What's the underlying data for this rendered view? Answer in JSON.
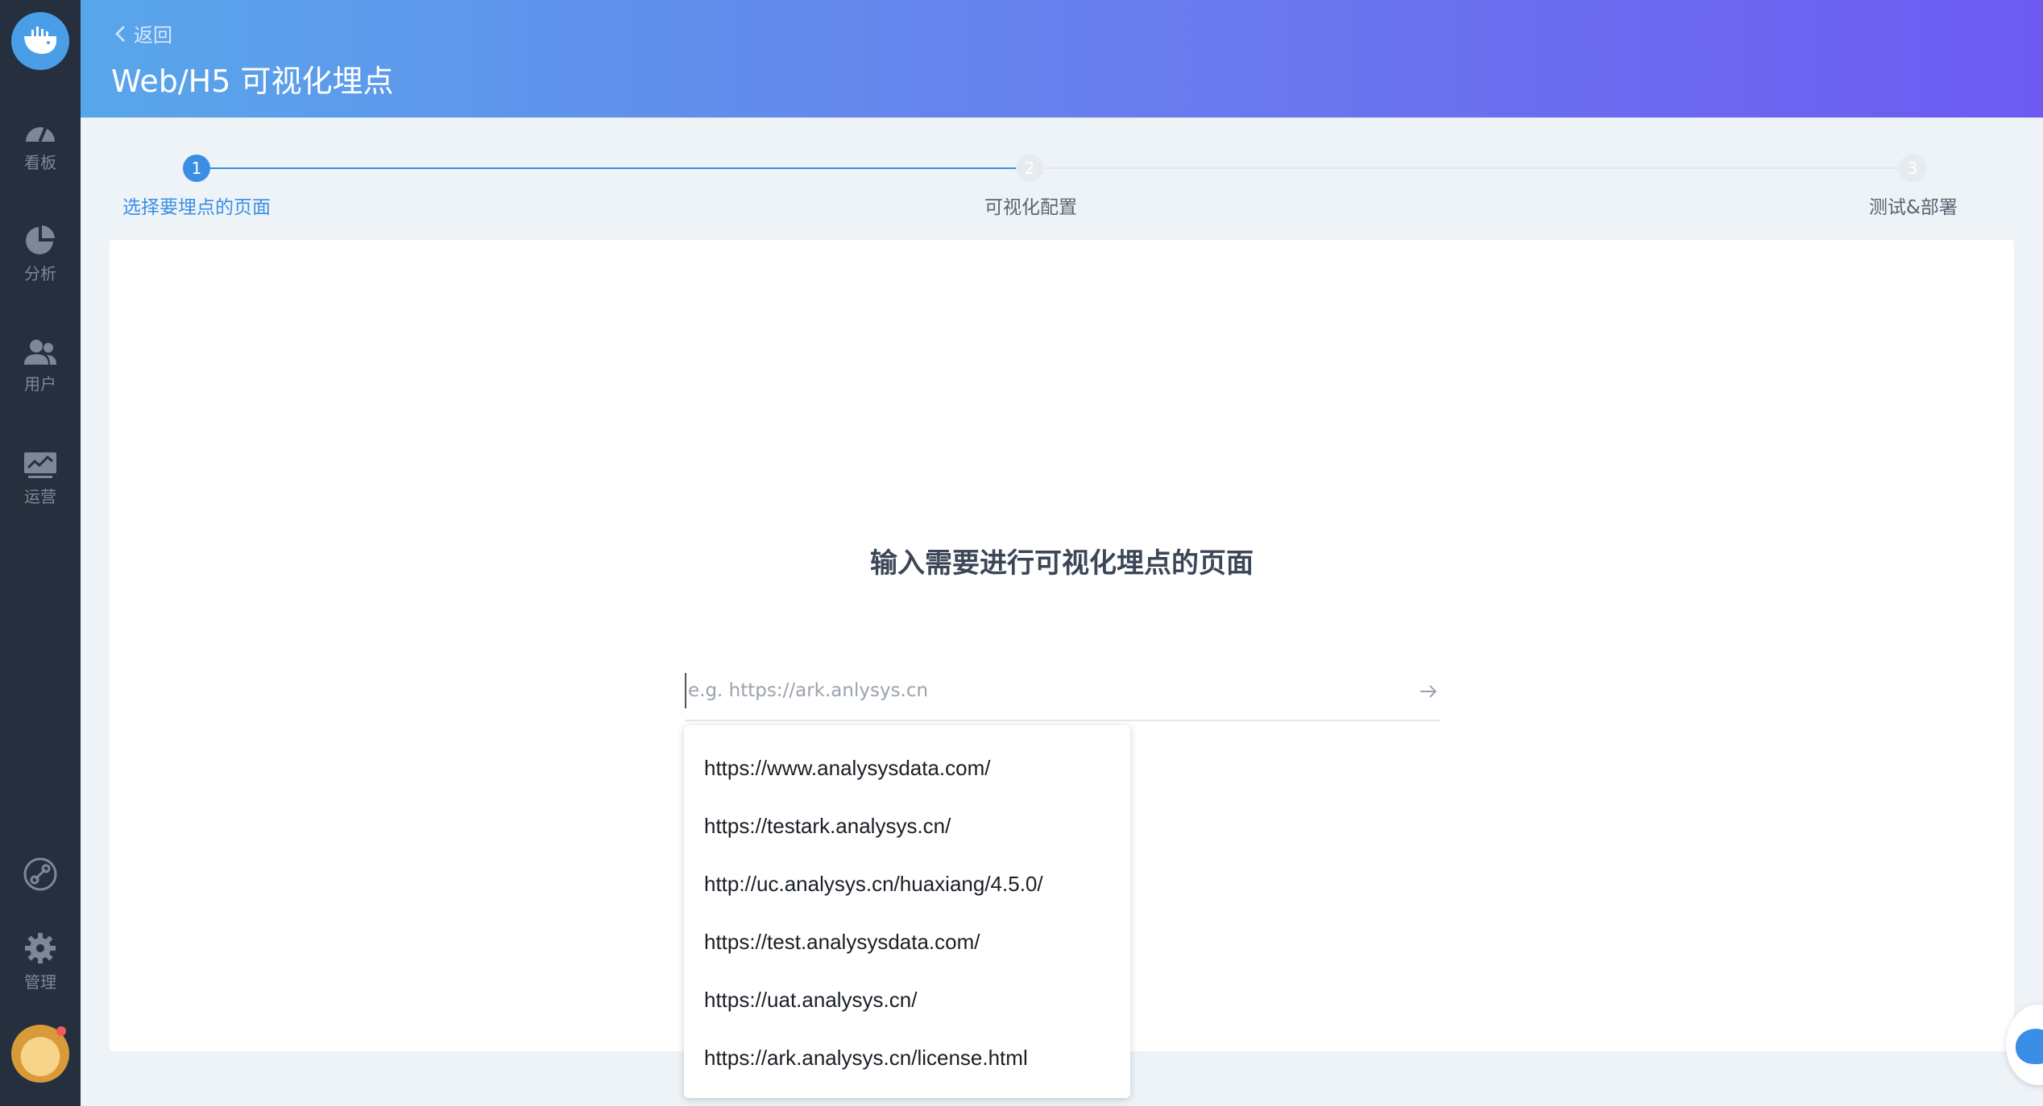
{
  "sidebar": {
    "items": [
      {
        "label": "看板",
        "icon": "dashboard-icon"
      },
      {
        "label": "分析",
        "icon": "pie-chart-icon"
      },
      {
        "label": "用户",
        "icon": "users-icon"
      },
      {
        "label": "运营",
        "icon": "monitor-icon"
      }
    ],
    "link_icon": "link-icon",
    "manage_label": "管理"
  },
  "header": {
    "back_label": "返回",
    "title": "Web/H5 可视化埋点"
  },
  "steps": [
    {
      "number": "1",
      "label": "选择要埋点的页面",
      "active": true
    },
    {
      "number": "2",
      "label": "可视化配置",
      "active": false
    },
    {
      "number": "3",
      "label": "测试&部署",
      "active": false
    }
  ],
  "main": {
    "prompt": "输入需要进行可视化埋点的页面",
    "url_placeholder": "e.g. https://ark.anlysys.cn",
    "url_value": "",
    "suggestions": [
      "https://www.analysysdata.com/",
      "https://testark.analysys.cn/",
      "http://uc.analysys.cn/huaxiang/4.5.0/",
      "https://test.analysysdata.com/",
      "https://uat.analysys.cn/",
      "https://ark.analysys.cn/license.html"
    ]
  },
  "colors": {
    "sidebar_bg": "#262f3d",
    "accent": "#3a8ee6",
    "header_start": "#58a6ea",
    "header_end": "#6d5af2"
  }
}
